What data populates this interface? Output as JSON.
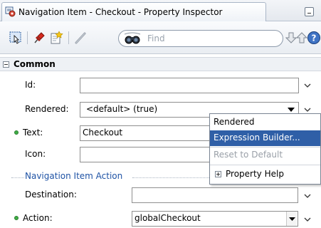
{
  "window": {
    "title": "Navigation Item - Checkout - Property Inspector"
  },
  "toolbar": {
    "search_placeholder": "Find"
  },
  "section": {
    "title": "Common"
  },
  "fields": {
    "id": {
      "label": "Id:",
      "value": ""
    },
    "rendered": {
      "label": "Rendered:",
      "value": "<default> (true)"
    },
    "text": {
      "label": "Text:",
      "value": "Checkout"
    },
    "icon": {
      "label": "Icon:",
      "value": ""
    },
    "destination": {
      "label": "Destination:",
      "value": ""
    },
    "action": {
      "label": "Action:",
      "value": "globalCheckout"
    }
  },
  "group": {
    "label": "Navigation Item Action"
  },
  "popup": {
    "items": [
      {
        "label": "Rendered"
      },
      {
        "label": "Expression Builder..."
      },
      {
        "label": "Reset to Default"
      },
      {
        "label": "Property Help"
      }
    ]
  },
  "colors": {
    "accent": "#2f5fa7",
    "group_label": "#1f53a5",
    "required_dot": "#3fae45"
  }
}
